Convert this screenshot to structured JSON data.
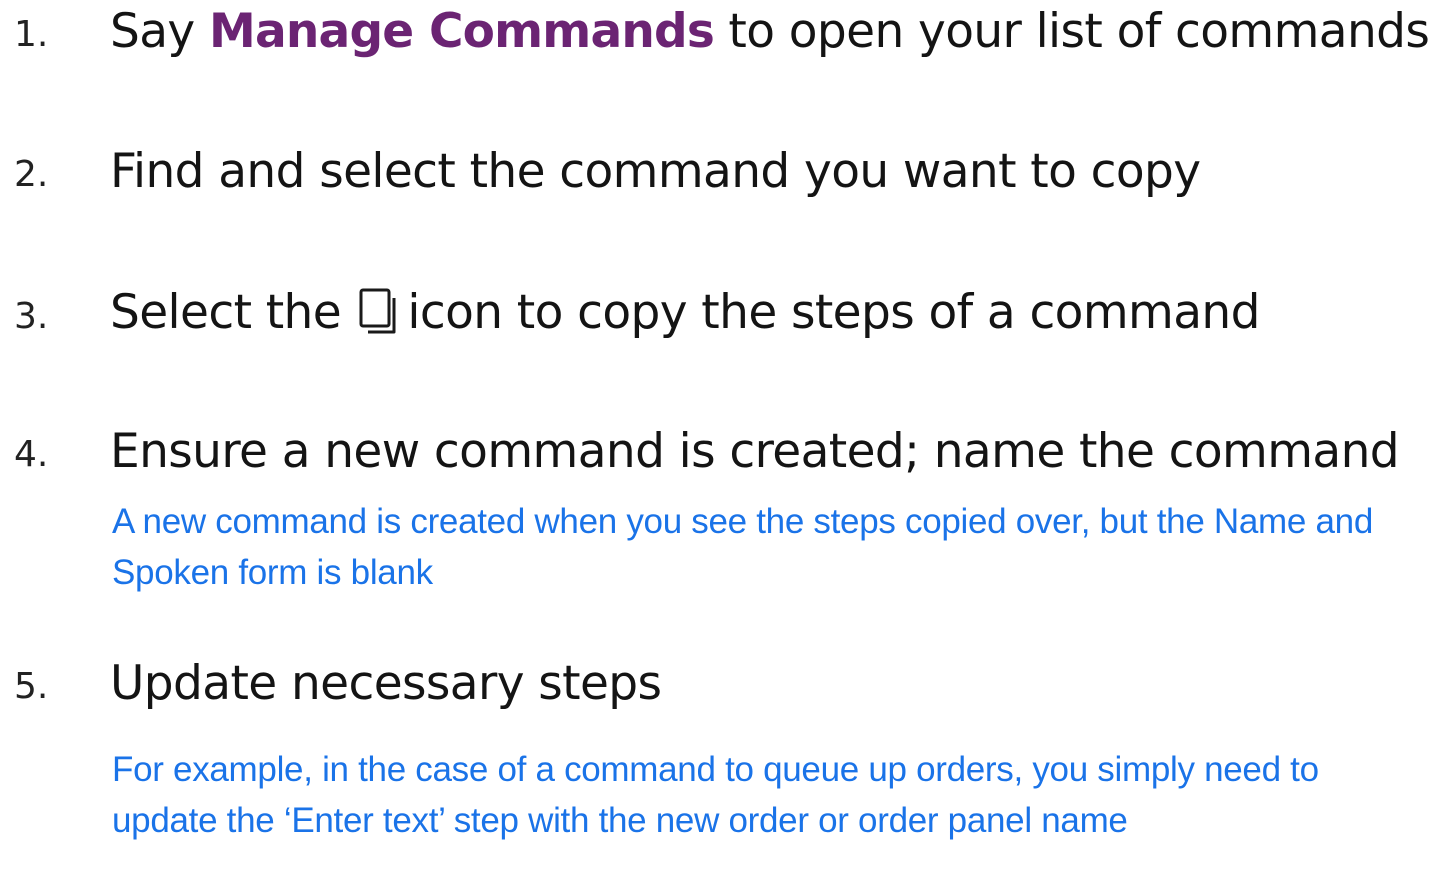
{
  "steps": [
    {
      "number": "1.",
      "before": "Say ",
      "emphasis": "Manage Commands",
      "after": " to open your list of commands"
    },
    {
      "number": "2.",
      "text": "Find and select the command you want to copy"
    },
    {
      "number": "3.",
      "before": "Select the ",
      "icon": "copy-icon",
      "after": "icon to copy the steps of a command"
    },
    {
      "number": "4.",
      "text": "Ensure a new command is created; name the command",
      "note": "A new command is created when you see the steps copied over, but the Name and Spoken form is blank"
    },
    {
      "number": "5.",
      "text": "Update necessary steps",
      "note": "For example, in the case of a command to queue up orders, you simply need to update the ‘Enter text’ step with the new order or order panel name"
    }
  ],
  "colors": {
    "emphasis": "#6b2473",
    "note": "#1a73e8",
    "text": "#141414"
  }
}
